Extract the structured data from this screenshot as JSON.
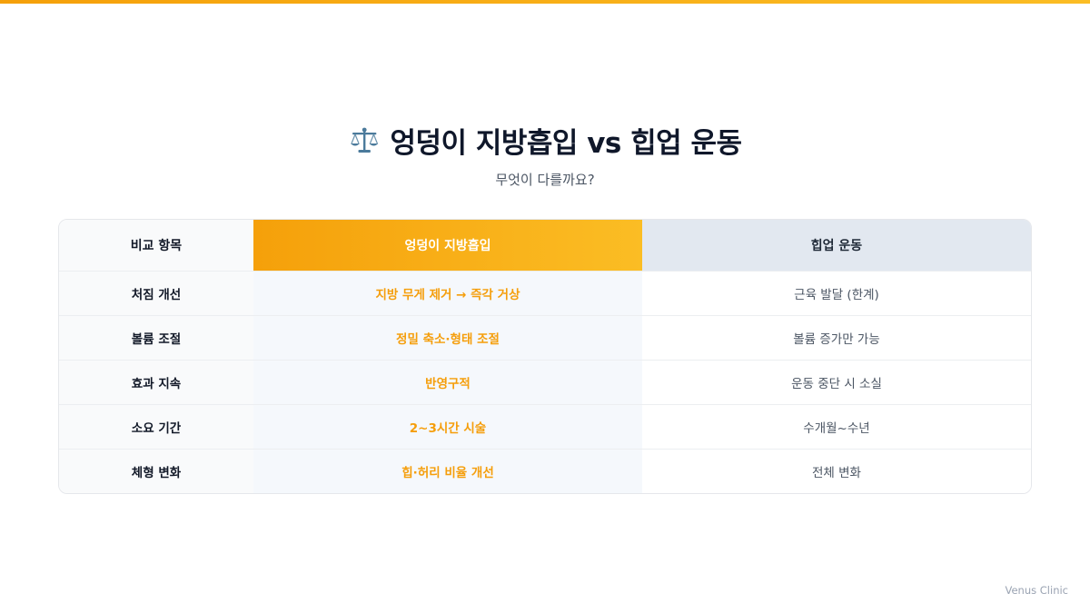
{
  "header": {
    "title": "엉덩이 지방흡입 vs 힙업 운동",
    "subtitle": "무엇이 다를까요?",
    "icon": "balance-scale-icon"
  },
  "table": {
    "headers": [
      "비교 항목",
      "엉덩이 지방흡입",
      "힙업 운동"
    ],
    "rows": [
      {
        "item": "처짐 개선",
        "lipo": "지방 무게 제거 → 즉각 거상",
        "exercise": "근육 발달 (한계)"
      },
      {
        "item": "볼륨 조절",
        "lipo": "정밀 축소·형태 조절",
        "exercise": "볼륨 증가만 가능"
      },
      {
        "item": "효과 지속",
        "lipo": "반영구적",
        "exercise": "운동 중단 시 소실"
      },
      {
        "item": "소요 기간",
        "lipo": "2~3시간 시술",
        "exercise": "수개월~수년"
      },
      {
        "item": "체형 변화",
        "lipo": "힙·허리 비율 개선",
        "exercise": "전체 변화"
      }
    ]
  },
  "footer": {
    "brand": "Venus Clinic"
  },
  "colors": {
    "accent": "#f5a00a",
    "accent_light": "#fbbd24",
    "exercise_header_bg": "#e2e8f0",
    "title_text": "#0f172a"
  }
}
